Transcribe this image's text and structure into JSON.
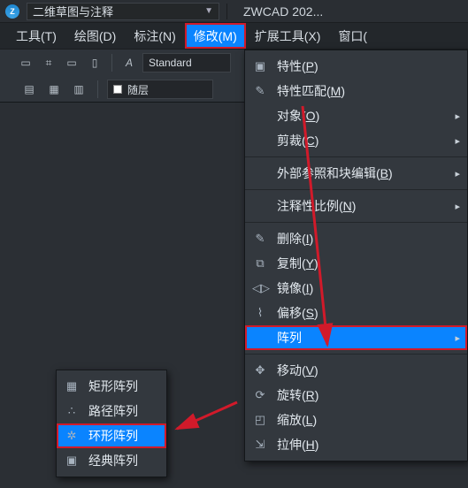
{
  "title": {
    "workspace": "二维草图与注释",
    "app": "ZWCAD 202..."
  },
  "menubar": {
    "tools": "工具(T)",
    "draw": "绘图(D)",
    "dim": "标注(N)",
    "modify": "修改(M)",
    "ext": "扩展工具(X)",
    "window": "窗口("
  },
  "toolbar": {
    "style_label": "Standard",
    "layer_label": "随层"
  },
  "modify_menu": {
    "properties": "特性",
    "properties_key": "P",
    "matchprop": "特性匹配",
    "matchprop_key": "M",
    "object": "对象",
    "object_key": "O",
    "clip": "剪裁",
    "clip_key": "C",
    "xref": "外部参照和块编辑",
    "xref_key": "B",
    "annoscale": "注释性比例",
    "annoscale_key": "N",
    "erase": "删除",
    "erase_key": "I",
    "copy": "复制",
    "copy_key": "Y",
    "mirror": "镜像",
    "mirror_key": "I",
    "offset": "偏移",
    "offset_key": "S",
    "array": "阵列",
    "move": "移动",
    "move_key": "V",
    "rotate": "旋转",
    "rotate_key": "R",
    "scale": "缩放",
    "scale_key": "L",
    "stretch": "拉伸",
    "stretch_key": "H"
  },
  "array_submenu": {
    "rect": "矩形阵列",
    "path": "路径阵列",
    "polar": "环形阵列",
    "classic": "经典阵列"
  }
}
